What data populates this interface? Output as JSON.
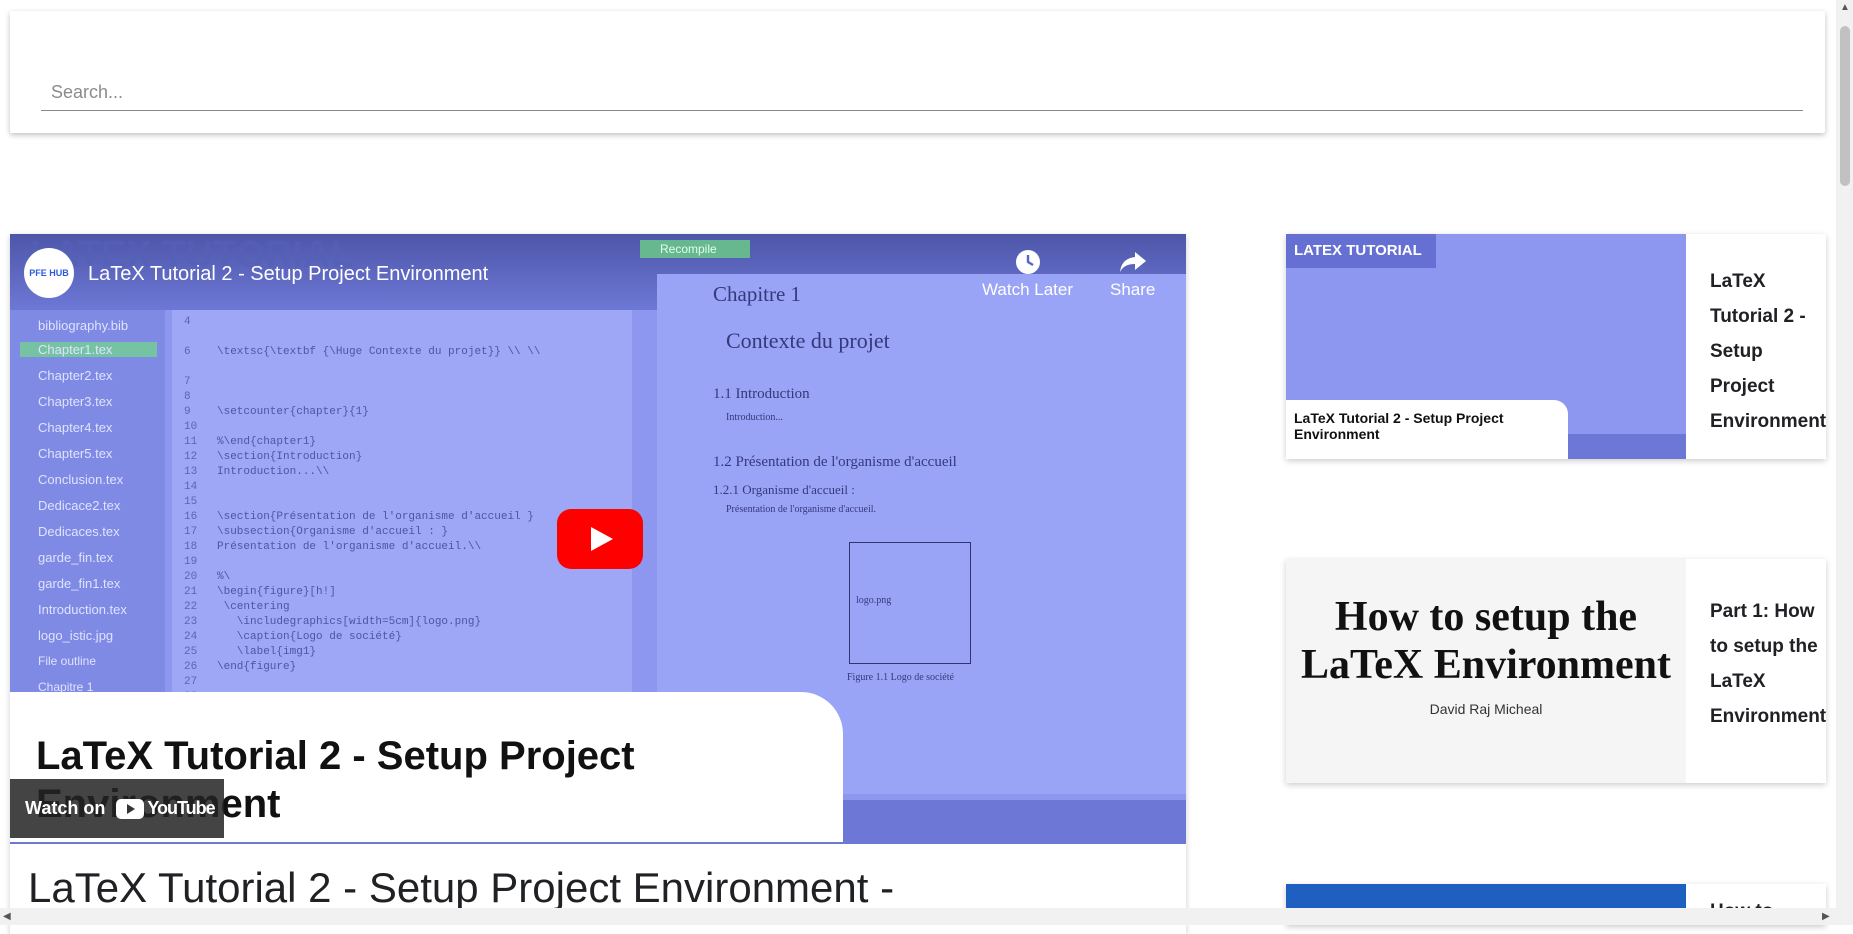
{
  "search": {
    "placeholder": "Search..."
  },
  "player": {
    "channel_logo_text": "PFE HUB",
    "title": "LaTeX Tutorial 2 - Setup Project Environment",
    "watch_later_label": "Watch Later",
    "share_label": "Share",
    "thumbnail_tag": "LATEX TUTORIAL",
    "caption": "LaTeX Tutorial 2 - Setup Project Environment",
    "watch_on_label": "Watch on",
    "youtube_label": "YouTube",
    "editor_files": [
      "bibliography.bib",
      "Chapter1.tex",
      "Chapter2.tex",
      "Chapter3.tex",
      "Chapter4.tex",
      "Chapter5.tex",
      "Conclusion.tex",
      "Dedicace2.tex",
      "Dedicaces.tex",
      "garde_fin.tex",
      "garde_fin1.tex",
      "Introduction.tex",
      "logo_istic.jpg",
      "File outline",
      "Chapitre 1"
    ],
    "pdf_chapter": "Chapitre 1",
    "pdf_heading": "Contexte du projet",
    "pdf_s1": "1.1   Introduction",
    "pdf_s1_text": "Introduction...",
    "pdf_s2": "1.2   Présentation de l'organisme d'accueil",
    "pdf_s21": "1.2.1   Organisme d'accueil :",
    "pdf_s21_text": "Présentation de l'organisme d'accueil.",
    "pdf_logo": "logo.png",
    "pdf_figure": "Figure 1.1   Logo de société",
    "recompile": "Recompile"
  },
  "main": {
    "heading": "LaTeX Tutorial 2 - Setup Project Environment -"
  },
  "sidebar": {
    "cards": [
      {
        "title": "LaTeX Tutorial 2 - Setup Project Environment",
        "thumb_tag": "LATEX TUTORIAL",
        "thumb_caption": "LaTeX Tutorial 2 - Setup Project Environment"
      },
      {
        "title": "Part 1: How to setup the LaTeX Environment",
        "thumb_line1": "How to setup the",
        "thumb_line2": "LaTeX Environment",
        "thumb_author": "David Raj Micheal"
      },
      {
        "title": "How to"
      }
    ]
  }
}
